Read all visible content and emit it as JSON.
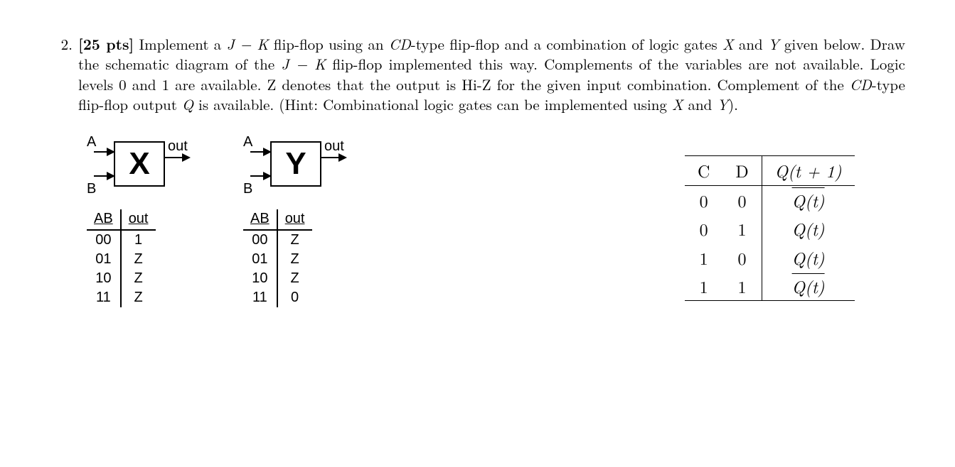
{
  "problem": {
    "number": "2.",
    "points_prefix": "[",
    "points": "25 pts",
    "points_suffix": "]",
    "text_parts": {
      "p1": " Implement a ",
      "jk1": "J − K",
      "p2": " flip-flop using an ",
      "cd1": "CD",
      "p3": "-type flip-flop and a combination of logic gates ",
      "x1": "X",
      "p4": " and ",
      "y1": "Y",
      "p5": " given below. Draw the schematic diagram of the ",
      "jk2": "J − K",
      "p6": " flip-flop implemented this way. Complements of the variables are not available. Logic levels 0 and 1 are available. Z denotes that the output is Hi-Z for the given input combination. Complement of the ",
      "cd2": "CD",
      "p7": "-type flip-flop output ",
      "q1": "Q",
      "p8": " is available. (Hint: Combinational logic gates can be implemented using ",
      "x2": "X",
      "p9": " and ",
      "y2": "Y",
      "p10": ")."
    }
  },
  "gates": {
    "x": {
      "label": "X",
      "in_a_label": "A",
      "in_b_label": "B",
      "out_label": "out",
      "truth": {
        "header_ab": "AB",
        "header_out": "out",
        "rows": [
          {
            "ab": "00",
            "out": "1"
          },
          {
            "ab": "01",
            "out": "Z"
          },
          {
            "ab": "10",
            "out": "Z"
          },
          {
            "ab": "11",
            "out": "Z"
          }
        ]
      }
    },
    "y": {
      "label": "Y",
      "in_a_label": "A",
      "in_b_label": "B",
      "out_label": "out",
      "truth": {
        "header_ab": "AB",
        "header_out": "out",
        "rows": [
          {
            "ab": "00",
            "out": "Z"
          },
          {
            "ab": "01",
            "out": "Z"
          },
          {
            "ab": "10",
            "out": "Z"
          },
          {
            "ab": "11",
            "out": "0"
          }
        ]
      }
    }
  },
  "cd_table": {
    "headers": {
      "c": "C",
      "d": "D",
      "q": "Q(t + 1)"
    },
    "rows": [
      {
        "c": "0",
        "d": "0",
        "q": "Q(t)",
        "bar": true
      },
      {
        "c": "0",
        "d": "1",
        "q": "Q(t)",
        "bar": false
      },
      {
        "c": "1",
        "d": "0",
        "q": "Q(t)",
        "bar": false
      },
      {
        "c": "1",
        "d": "1",
        "q": "Q(t)",
        "bar": true
      }
    ]
  }
}
